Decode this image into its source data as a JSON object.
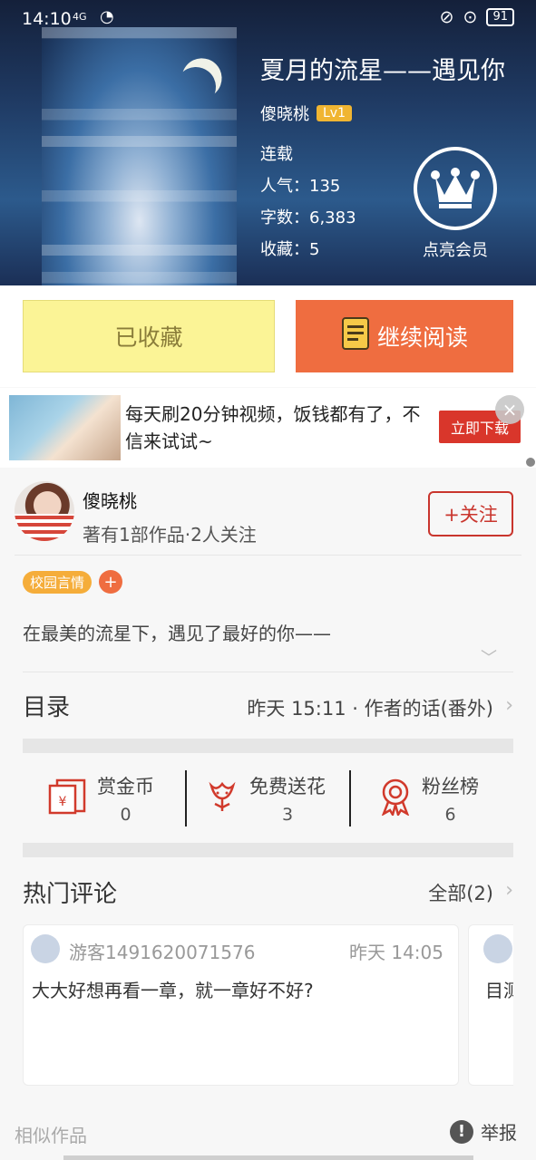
{
  "status_bar": {
    "time": "14:10",
    "network": "4G",
    "battery": "91"
  },
  "book": {
    "title": "夏月的流星——遇见你",
    "author": "傻晓桃",
    "level": "Lv1",
    "status": "连载",
    "popularity": "人气：135",
    "word_count": "字数：6,383",
    "favorites": "收藏：5",
    "vip_label": "点亮会员"
  },
  "actions": {
    "favorited_label": "已收藏",
    "continue_label": "继续阅读"
  },
  "ad": {
    "text": "每天刷20分钟视频，饭钱都有了，不信来试试~",
    "button": "立即下载",
    "close": "×"
  },
  "author_card": {
    "name": "傻晓桃",
    "summary": "著有1部作品·2人关注",
    "follow_label": "+关注"
  },
  "tags": [
    "校园言情"
  ],
  "tag_add": "+",
  "intro": "在最美的流星下，遇见了最好的你——",
  "toc": {
    "title": "目录",
    "latest": "昨天 15:11 · 作者的话(番外)"
  },
  "stats": [
    {
      "label": "赏金币",
      "value": "0",
      "icon": "reward-coin-icon"
    },
    {
      "label": "免费送花",
      "value": "3",
      "icon": "flower-icon"
    },
    {
      "label": "粉丝榜",
      "value": "6",
      "icon": "medal-icon"
    }
  ],
  "hot_comments": {
    "title": "热门评论",
    "all_label": "全部(2)",
    "items": [
      {
        "user": "游客1491620071576",
        "time": "昨天 14:05",
        "text": "大大好想再看一章，就一章好不好?"
      },
      {
        "user": "",
        "time": "",
        "text": "目测"
      }
    ]
  },
  "footer": {
    "similar": "相似作品",
    "report": "举报",
    "report_icon": "!"
  },
  "colors": {
    "accent_orange": "#ef6d40",
    "favorite_yellow": "#fbf496",
    "follow_red": "#c9352d",
    "tag_orange": "#f5ad3a"
  }
}
